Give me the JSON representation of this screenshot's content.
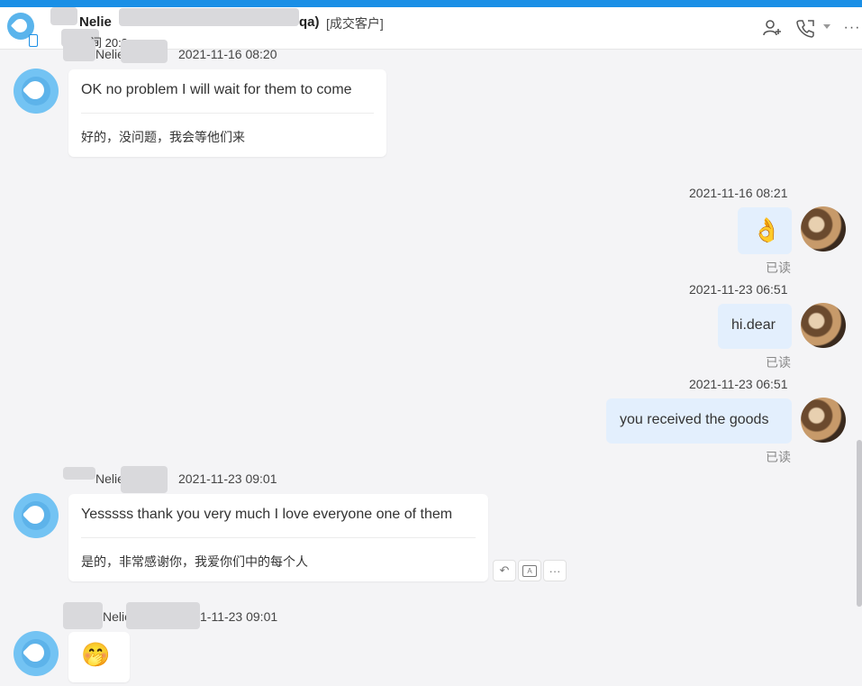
{
  "header": {
    "name": "Nelie",
    "name_suffix": "qa)",
    "tag": "[成交客户]",
    "subtitle": "间 20:3",
    "icons": [
      "avatar",
      "phone-icon",
      "add-contact-icon",
      "call-icon",
      "chevron-down-icon",
      "more-icon"
    ]
  },
  "messages": [
    {
      "side": "left",
      "sender": "Nelie",
      "time": "2021-11-16 08:20",
      "text": "OK no problem I will wait for them to come",
      "translation": "好的，没问题，我会等他们来"
    },
    {
      "side": "right",
      "time": "2021-11-16 08:21",
      "emoji": "👌",
      "status": "已读"
    },
    {
      "side": "right",
      "time": "2021-11-23 06:51",
      "text": "hi.dear",
      "status": "已读"
    },
    {
      "side": "right",
      "time": "2021-11-23 06:51",
      "text": "you received the goods",
      "status": "已读"
    },
    {
      "side": "left",
      "sender": "Nelie",
      "time": "2021-11-23 09:01",
      "text": "Yesssss thank you very much I love everyone one of them",
      "translation": "是的，非常感谢你，我爱你们中的每个人",
      "actions": [
        "reply-icon",
        "translate-icon",
        "more-icon"
      ]
    },
    {
      "side": "left",
      "sender": "Nelie",
      "time": "1-11-23 09:01",
      "emoji": "🤭"
    }
  ],
  "actions_glyphs": {
    "reply": "↶",
    "translate": "A",
    "more": "···"
  },
  "colors": {
    "accent": "#1a8fe6",
    "bubble_right": "#e3effd",
    "bubble_left": "#ffffff",
    "background": "#f4f4f6"
  }
}
